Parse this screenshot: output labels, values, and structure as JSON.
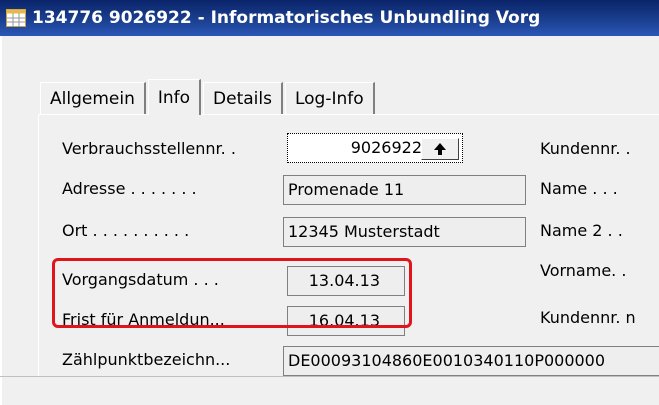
{
  "window": {
    "title": "134776 9026922 - Informatorisches Unbundling Vorg",
    "title_icon": "table-form-icon"
  },
  "tabs": [
    {
      "label": "Allgemein",
      "active": false
    },
    {
      "label": "Info",
      "active": true
    },
    {
      "label": "Details",
      "active": false
    },
    {
      "label": "Log-Info",
      "active": false
    }
  ],
  "fields_left": {
    "verbrauchsstellennr": {
      "label": "Verbrauchsstellennr. .",
      "value": "9026922"
    },
    "adresse": {
      "label": "Adresse . . . . . . .",
      "value": "Promenade 11"
    },
    "ort": {
      "label": "Ort . . . . . . . . . .",
      "value": "12345 Musterstadt"
    },
    "vorgangsdatum": {
      "label": "Vorgangsdatum . . .",
      "value": "13.04.13"
    },
    "frist": {
      "label": "Frist für Anmeldun...",
      "value": "16.04.13"
    },
    "zaehlpunkt": {
      "label": "Zählpunktbezeichn...",
      "value": "DE00093104860E0010340110P000000"
    }
  },
  "fields_right": {
    "kundennr": {
      "label": "Kundennr. ."
    },
    "name": {
      "label": "Name . . ."
    },
    "name2": {
      "label": "Name 2 . ."
    },
    "vorname": {
      "label": "Vorname. ."
    },
    "kundennr2": {
      "label": "Kundennr. n"
    }
  },
  "highlight": {
    "color": "#e0141b"
  },
  "colors": {
    "titlebar": "#0a246a",
    "window_bg": "#f0f0f0"
  }
}
